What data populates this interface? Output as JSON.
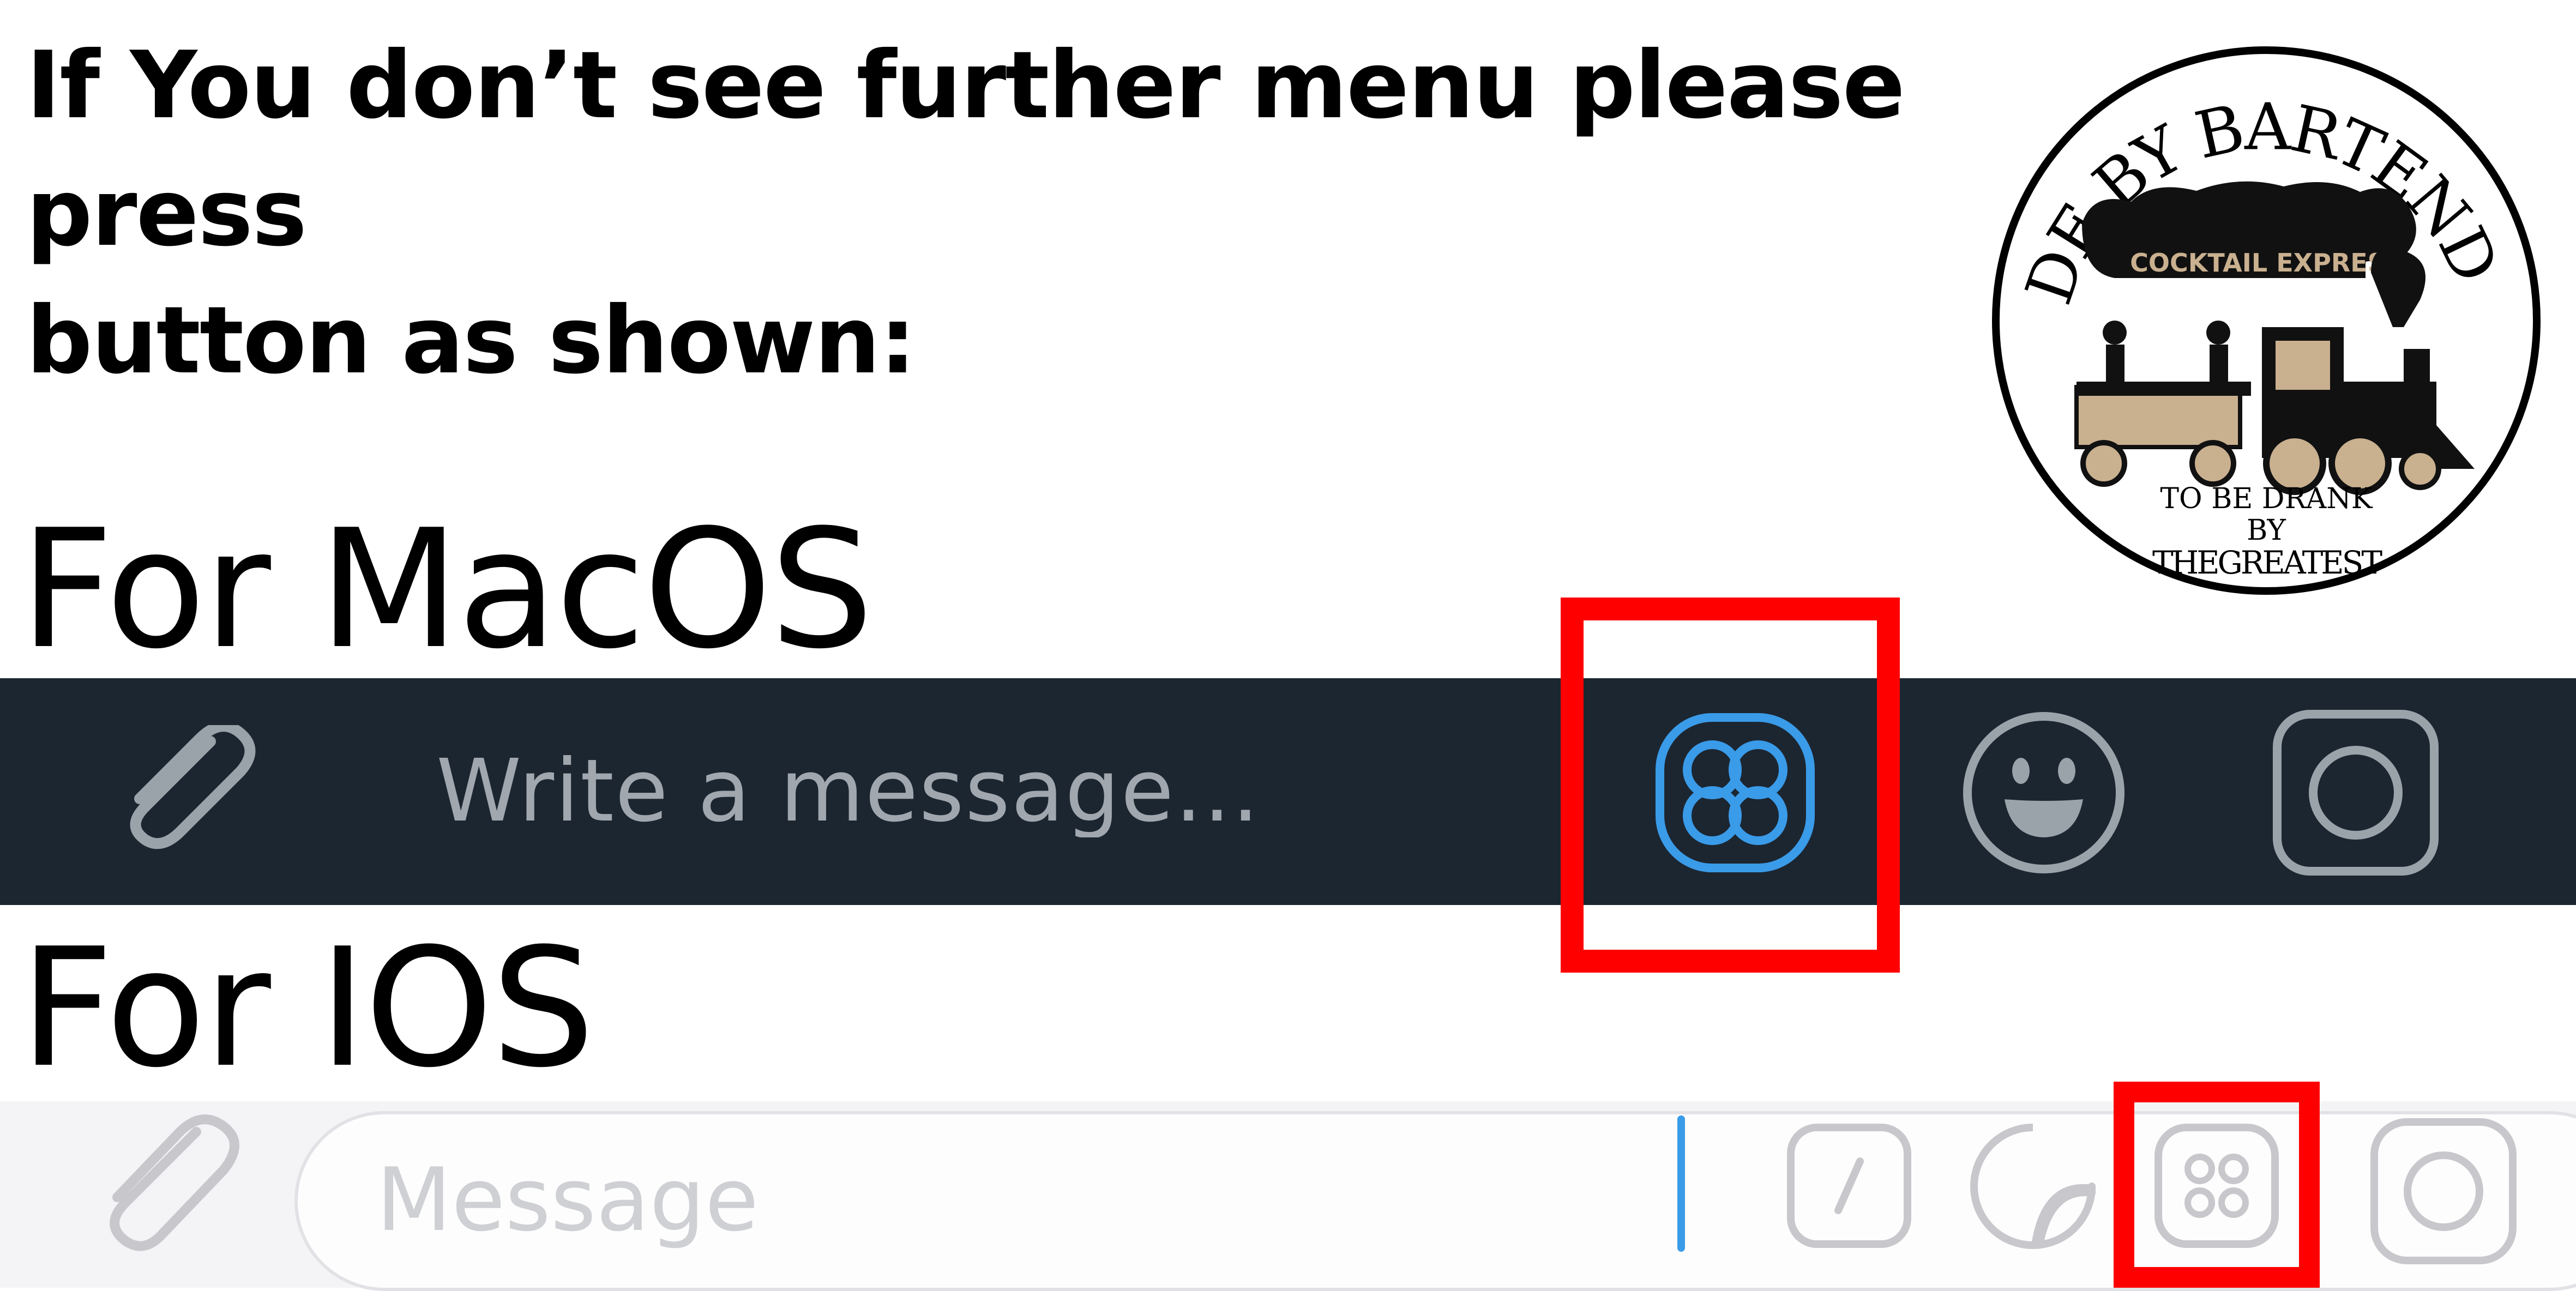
{
  "instruction": {
    "line1": "If You don’t see further menu please press",
    "line2": "button as shown:"
  },
  "macos": {
    "label": "For MacOS",
    "input_placeholder": "Write a message...",
    "icons": [
      "paperclip-icon",
      "bot-menu-icon",
      "emoji-icon",
      "camera-icon"
    ],
    "colors": {
      "bar": "#1c2631",
      "accent": "#3a9be8",
      "icon": "#9aa2aa"
    }
  },
  "ios": {
    "label": "For IOS",
    "input_placeholder": "Message",
    "icons": [
      "paperclip-icon",
      "slash-command-icon",
      "sticker-icon",
      "bot-menu-icon",
      "camera-icon"
    ],
    "colors": {
      "bar": "#f4f4f6",
      "icon": "#c8c8cc",
      "caret": "#3a9be8"
    }
  },
  "highlight_color": "#ff0000",
  "logo": {
    "top_text": "MADE BY BARTENDERS",
    "banner": "COCKTAIL EXPRESS",
    "line1": "TO BE DRANK",
    "line2": "BY",
    "line3": "THEGREATEST"
  }
}
